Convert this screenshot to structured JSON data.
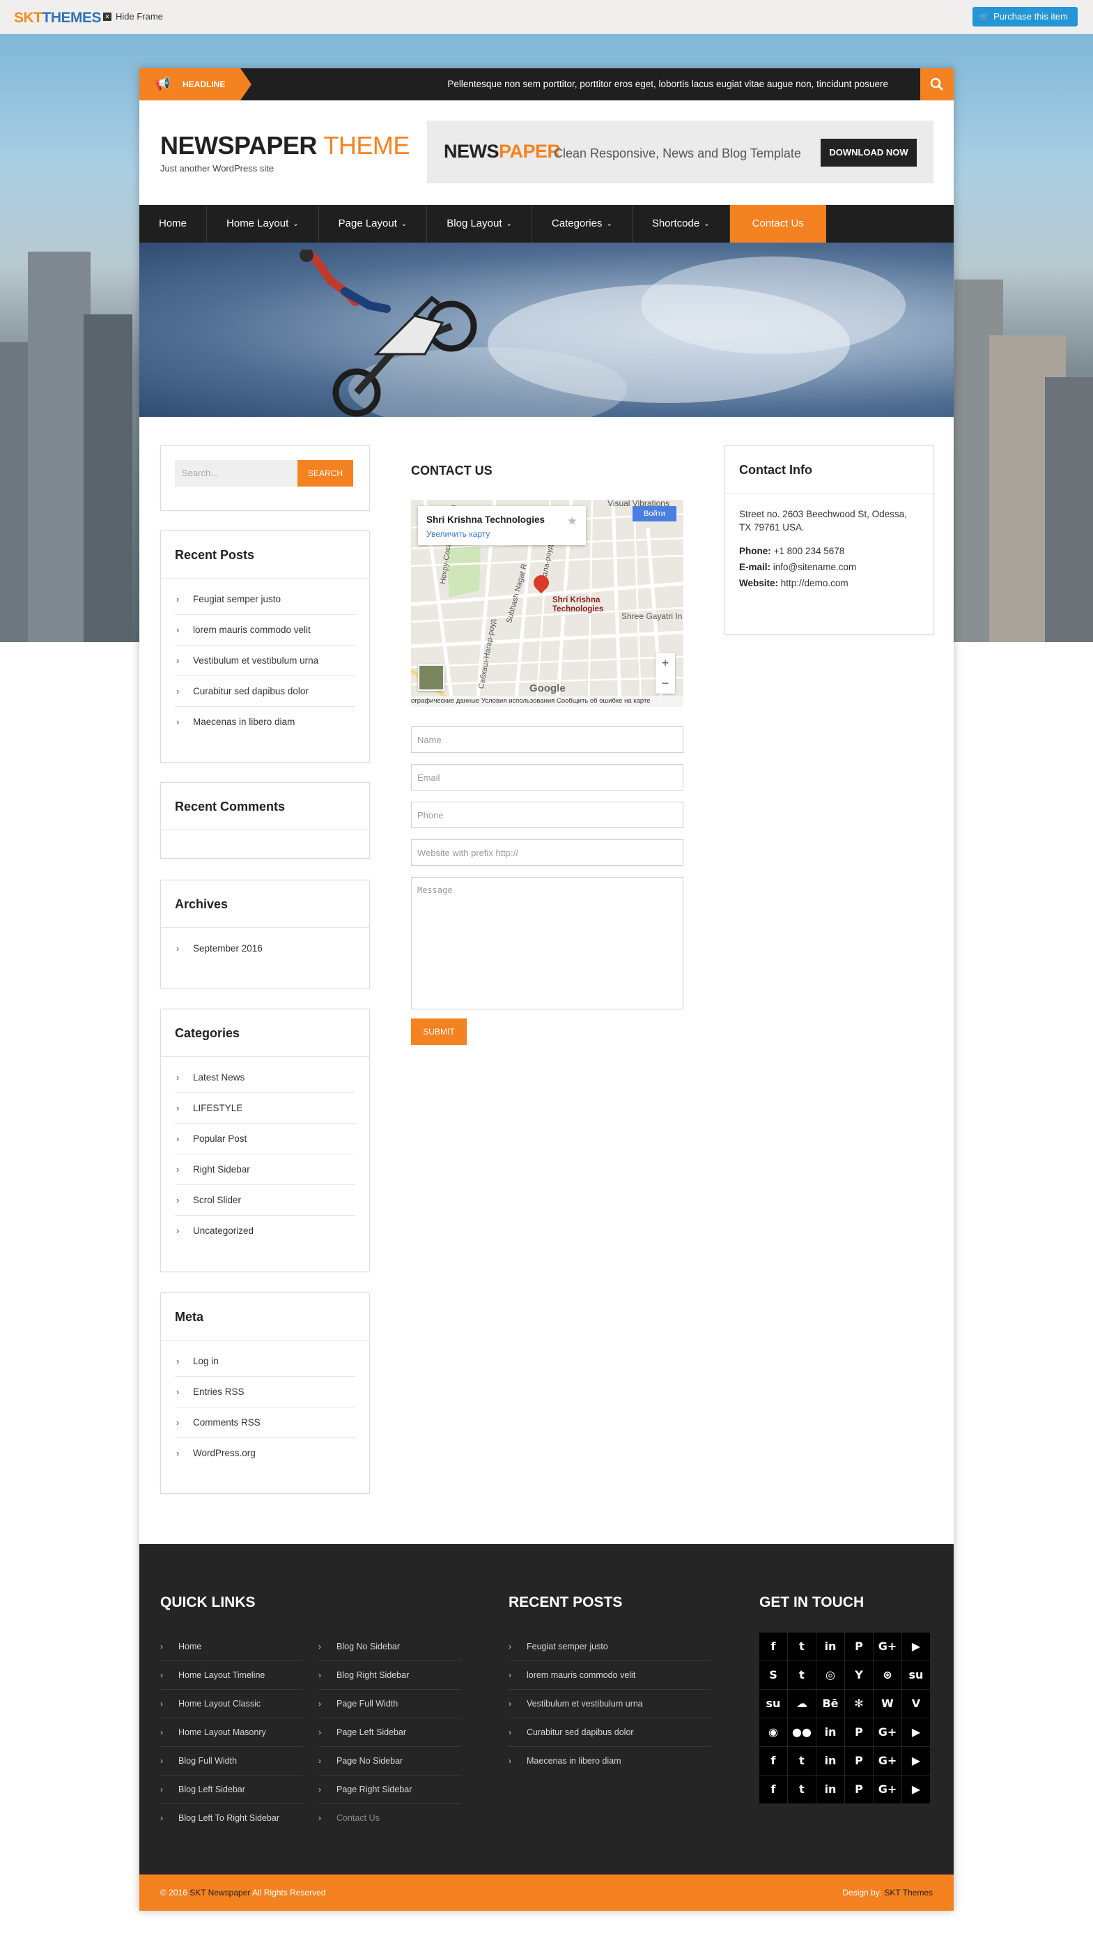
{
  "topbar": {
    "logo_skt": "SKT",
    "logo_themes": "THEMES",
    "hide_frame": "Hide Frame",
    "purchase": "Purchase this item"
  },
  "headline": {
    "tag": "HEADLINE",
    "ticker": "Pellentesque non sem porttitor, porttitor eros eget, lobortis lacus eugiat vitae augue non, tincidunt posuere"
  },
  "brand": {
    "name_main": "NEWSPAPER",
    "name_accent": "THEME",
    "tagline": "Just another WordPress site"
  },
  "banner": {
    "news": "NEWS",
    "paper": "PAPER",
    "text": "Clean Responsive, News and Blog Template",
    "button": "DOWNLOAD NOW"
  },
  "nav": {
    "items": [
      {
        "label": "Home"
      },
      {
        "label": "Home Layout"
      },
      {
        "label": "Page Layout"
      },
      {
        "label": "Blog Layout"
      },
      {
        "label": "Categories"
      },
      {
        "label": "Shortcode"
      },
      {
        "label": "Contact Us"
      }
    ]
  },
  "search": {
    "placeholder": "Search...",
    "button": "SEARCH"
  },
  "recent_posts": {
    "title": "Recent Posts",
    "items": [
      "Feugiat semper justo",
      "lorem mauris commodo velit",
      "Vestibulum et vestibulum urna",
      "Curabitur sed dapibus dolor",
      "Maecenas in libero diam"
    ]
  },
  "recent_comments": {
    "title": "Recent Comments"
  },
  "archives": {
    "title": "Archives",
    "items": [
      "September 2016"
    ]
  },
  "categories": {
    "title": "Categories",
    "items": [
      "Latest News",
      "LIFESTYLE",
      "Popular Post",
      "Right Sidebar",
      "Scrol Slider",
      "Uncategorized"
    ]
  },
  "meta": {
    "title": "Meta",
    "items": [
      "Log in",
      "Entries RSS",
      "Comments RSS",
      "WordPress.org"
    ]
  },
  "contact": {
    "title": "CONTACT US",
    "map": {
      "place": "Shri Krishna Technologies",
      "enlarge": "Увеличить карту",
      "login": "Войти",
      "pin_label_1": "Shri Krishna",
      "pin_label_2": "Technologies",
      "nearby": "Shree Gayatri In",
      "visual": "Visual Vibrations",
      "road_1": "Subhash Nagar R",
      "road_2": "Сабхаш-Нагар-роуд",
      "road_3": "Нехру-Сосайети-Мейн",
      "road_4": "Кала-роуд",
      "google": "Google",
      "footer": "ографические данные    Условия использования    Сообщить об ошибке на карте"
    },
    "fields": {
      "name": "Name",
      "email": "Email",
      "phone": "Phone",
      "website": "Website with prefix http://",
      "message": "Message"
    },
    "submit": "SUBMIT"
  },
  "contact_info": {
    "title": "Contact Info",
    "address": "Street no. 2603 Beechwood St, Odessa, TX 79761 USA.",
    "phone_label": "Phone:",
    "phone": "+1 800 234 5678",
    "email_label": "E-mail:",
    "email": "info@sitename.com",
    "website_label": "Website:",
    "website": "http://demo.com"
  },
  "footer": {
    "quick_links_title": "QUICK LINKS",
    "quick_links_col1": [
      "Home",
      "Home Layout Timeline",
      "Home Layout Classic",
      "Home Layout Masonry",
      "Blog Full Width",
      "Blog Left Sidebar",
      "Blog Left To Right Sidebar"
    ],
    "quick_links_col2": [
      "Blog No Sidebar",
      "Blog Right Sidebar",
      "Page Full Width",
      "Page Left Sidebar",
      "Page No Sidebar",
      "Page Right Sidebar",
      "Contact Us"
    ],
    "recent_posts_title": "RECENT POSTS",
    "recent_posts": [
      "Feugiat semper justo",
      "lorem mauris commodo velit",
      "Vestibulum et vestibulum urna",
      "Curabitur sed dapibus dolor",
      "Maecenas in libero diam"
    ],
    "touch_title": "GET IN TOUCH",
    "social": [
      {
        "glyph": "f",
        "icon": "facebook-icon"
      },
      {
        "glyph": "t",
        "icon": "twitter-icon"
      },
      {
        "glyph": "in",
        "icon": "linkedin-icon"
      },
      {
        "glyph": "P",
        "icon": "pinterest-icon"
      },
      {
        "glyph": "G+",
        "icon": "google-plus-icon"
      },
      {
        "glyph": "▶",
        "icon": "youtube-icon"
      },
      {
        "glyph": "S",
        "icon": "skype-icon"
      },
      {
        "glyph": "t",
        "icon": "tumblr-icon"
      },
      {
        "glyph": "◎",
        "icon": "instagram-icon"
      },
      {
        "glyph": "Y",
        "icon": "yahoo-icon"
      },
      {
        "glyph": "⊛",
        "icon": "dribbble-icon"
      },
      {
        "glyph": "su",
        "icon": "stumbleupon-icon"
      },
      {
        "glyph": "su",
        "icon": "stumbleupon-icon"
      },
      {
        "glyph": "☁",
        "icon": "soundcloud-icon"
      },
      {
        "glyph": "Bē",
        "icon": "behance-icon"
      },
      {
        "glyph": "✻",
        "icon": "yelp-icon"
      },
      {
        "glyph": "W",
        "icon": "wordpress-icon"
      },
      {
        "glyph": "V",
        "icon": "vine-icon"
      },
      {
        "glyph": "◉",
        "icon": "rss-icon"
      },
      {
        "glyph": "●●",
        "icon": "flickr-icon"
      },
      {
        "glyph": "in",
        "icon": "linkedin-icon"
      },
      {
        "glyph": "P",
        "icon": "pinterest-icon"
      },
      {
        "glyph": "G+",
        "icon": "google-plus-icon"
      },
      {
        "glyph": "▶",
        "icon": "youtube-icon"
      },
      {
        "glyph": "f",
        "icon": "facebook-icon"
      },
      {
        "glyph": "t",
        "icon": "twitter-icon"
      },
      {
        "glyph": "in",
        "icon": "linkedin-icon"
      },
      {
        "glyph": "P",
        "icon": "pinterest-icon"
      },
      {
        "glyph": "G+",
        "icon": "google-plus-icon"
      },
      {
        "glyph": "▶",
        "icon": "youtube-icon"
      },
      {
        "glyph": "f",
        "icon": "facebook-icon"
      },
      {
        "glyph": "t",
        "icon": "twitter-icon"
      },
      {
        "glyph": "in",
        "icon": "linkedin-icon"
      },
      {
        "glyph": "P",
        "icon": "pinterest-icon"
      },
      {
        "glyph": "G+",
        "icon": "google-plus-icon"
      },
      {
        "glyph": "▶",
        "icon": "youtube-icon"
      }
    ]
  },
  "bottombar": {
    "copyright_pre": "© 2016",
    "copyright_name": "SKT Newspaper",
    "copyright_post": "All Rights Reserved",
    "design_pre": "Design by:",
    "design_name": "SKT Themes"
  },
  "colors": {
    "accent": "#f58220",
    "dark": "#1f1f1f",
    "purchase": "#2495d5"
  }
}
